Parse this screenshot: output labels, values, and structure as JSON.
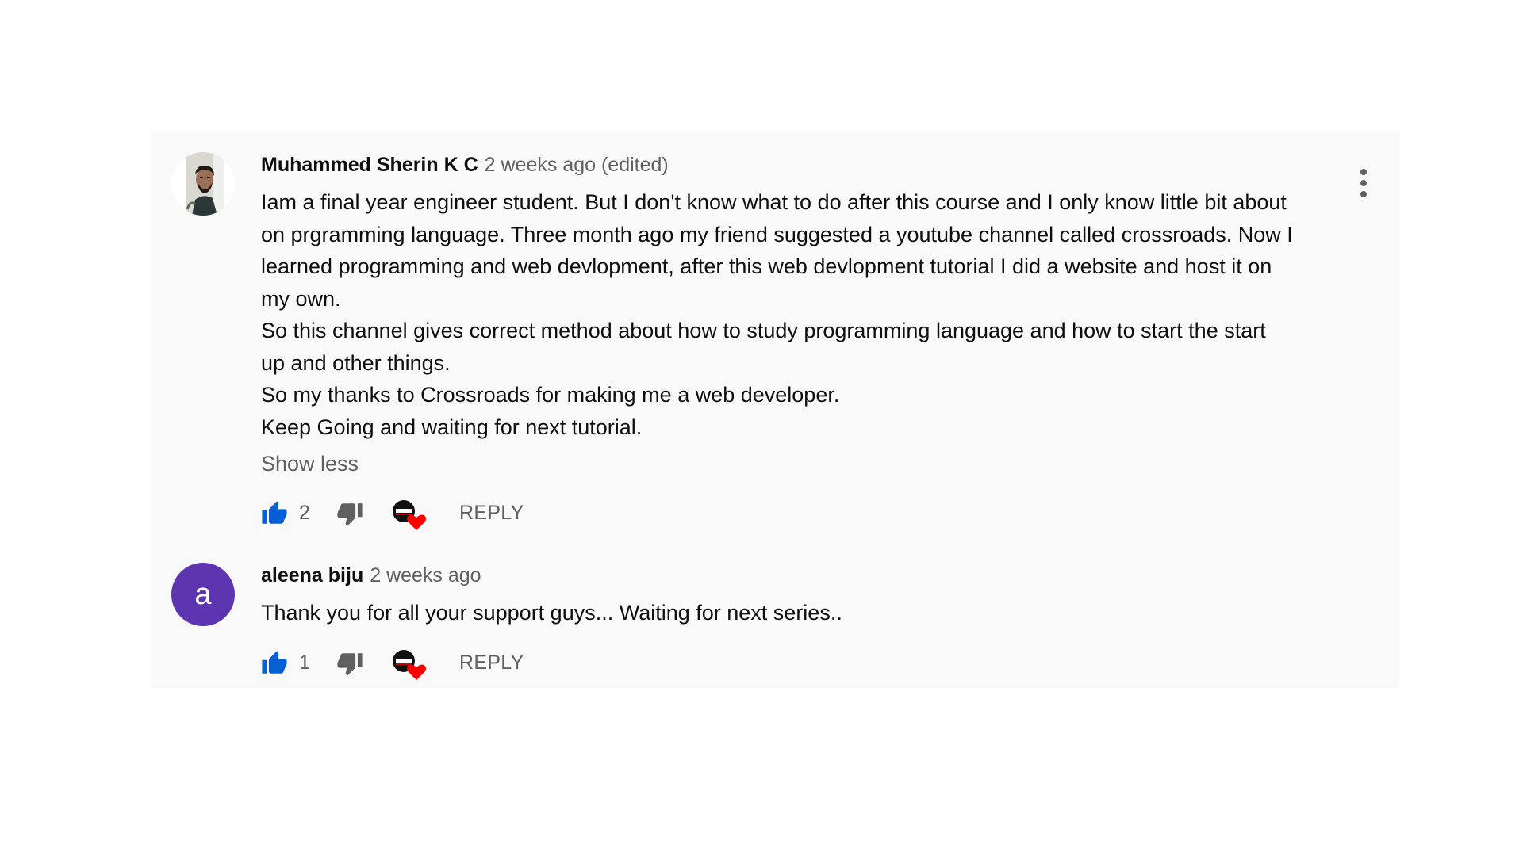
{
  "comments": [
    {
      "author": "Muhammed Sherin K C",
      "time": "2 weeks ago (edited)",
      "avatar_icon": "profile-photo",
      "lines": [
        "Iam a final year engineer student. But I don't know what to do after this course and I only know little bit about",
        "on prgramming language. Three month ago my friend suggested a youtube channel called crossroads. Now I",
        "learned programming and web devlopment, after this web devlopment tutorial  I did a website and host it on",
        "my own.",
        "So this channel gives correct method about how to study programming language and how to start the start",
        "up and other things.",
        "So my thanks to Crossroads for making me a web developer.",
        "Keep Going and waiting for next tutorial."
      ],
      "show_less": "Show less",
      "likes": "2",
      "reply": "REPLY"
    },
    {
      "author": "aleena biju",
      "time": "2 weeks ago",
      "avatar_letter": "a",
      "avatar_color": "#5e35b1",
      "lines": [
        "Thank you for all your support guys... Waiting for next series.."
      ],
      "likes": "1",
      "reply": "REPLY"
    }
  ],
  "icons": {
    "like": "thumbs-up-icon",
    "dislike": "thumbs-down-icon",
    "creator_heart": "creator-heart-icon",
    "menu": "more-vert-icon"
  },
  "colors": {
    "like_blue": "#065fd4",
    "heart_red": "#ff0000",
    "secondary_text": "#606060"
  }
}
